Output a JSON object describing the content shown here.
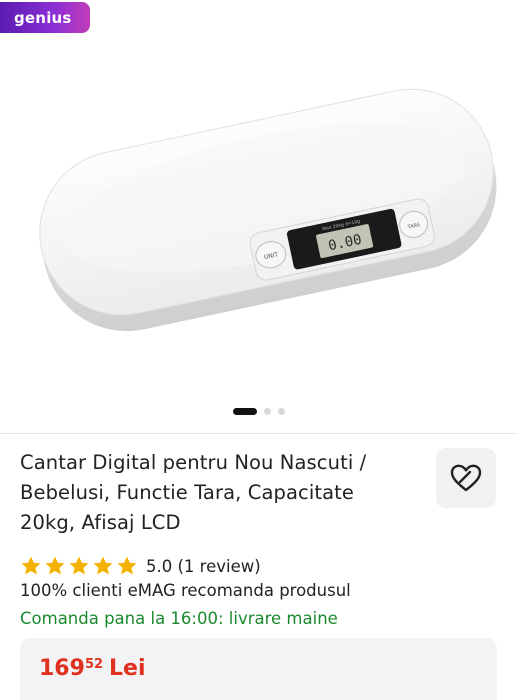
{
  "badge": {
    "label": "genius"
  },
  "gallery": {
    "image_name": "baby-scale-product-image",
    "scale_labels": {
      "unit": "UNIT",
      "tare": "TARE",
      "lcd": "0.00",
      "top_text": "Max 20kg d=10g"
    },
    "dots": 3,
    "active_dot": 0
  },
  "product": {
    "title": "Cantar Digital pentru Nou Nascuti / Bebelusi, Functie Tara, Capacitate 20kg, Afisaj LCD",
    "rating_value": 5.0,
    "rating_text": "5.0 (1 review)",
    "stars": 5,
    "recommend_text": "100% clienti eMAG recomanda produsul",
    "delivery_text": "Comanda pana la 16:00: livrare maine",
    "price_main": "169",
    "price_cents": "52",
    "currency": "Lei"
  },
  "icons": {
    "favorite": "heart-outline-icon",
    "star": "star-icon"
  },
  "colors": {
    "star": "#f5b301",
    "price": "#e0301e",
    "delivery": "#1b8a2f",
    "badge_start": "#5b1bb0",
    "badge_end": "#c13cb8"
  }
}
